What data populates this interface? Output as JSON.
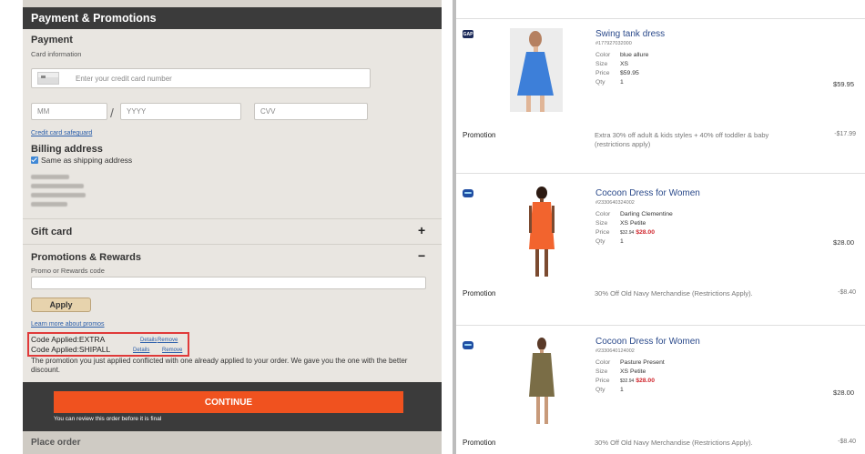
{
  "payment_panel": {
    "header": "Payment & Promotions",
    "payment": {
      "title": "Payment",
      "card_info_label": "Card information",
      "card_number_placeholder": "Enter your credit card number",
      "month_placeholder": "MM",
      "separator": "/",
      "year_placeholder": "YYYY",
      "cvv_placeholder": "CVV",
      "safeguard_link": "Credit card safeguard"
    },
    "billing": {
      "title": "Billing address",
      "same_as_shipping_label": "Same as shipping address",
      "same_as_shipping_checked": true
    },
    "gift_card": {
      "title": "Gift card",
      "toggle": "+"
    },
    "promotions": {
      "title": "Promotions & Rewards",
      "toggle": "−",
      "code_label": "Promo or Rewards code",
      "code_value": "",
      "apply_label": "Apply",
      "learn_more_link": "Learn more about promos",
      "applied_codes": [
        {
          "text": "Code Applied:EXTRA",
          "details": "Details",
          "remove": "Remove"
        },
        {
          "text": "Code Applied:SHIPALL",
          "details": "Details",
          "remove": "Remove"
        }
      ],
      "conflict_message": "The promotion you just applied conflicted with one already applied to your order. We gave you the one with the better discount."
    },
    "continue_label": "CONTINUE",
    "review_note": "You can review this order before it is final",
    "place_order_title": "Place order"
  },
  "order_summary": {
    "items": [
      {
        "brand_icon": "gap-logo",
        "brand_text": "GAP",
        "title": "Swing tank dress",
        "sku": "#177927032000",
        "color": "blue allure",
        "size": "XS",
        "price_label": "$59.95",
        "qty": "1",
        "line_total": "$59.95",
        "promo_label": "Promotion",
        "promo_description": "Extra 30% off adult & kids styles + 40% off toddler & baby (restrictions apply)",
        "promo_amount": "-$17.99",
        "dress_color": "#3d7fd9"
      },
      {
        "brand_icon": "old-navy-logo",
        "title": "Cocoon Dress for Women",
        "sku": "#2330640324002",
        "color": "Darling Clementine",
        "size": "XS Petite",
        "price_original": "$32.94",
        "price_sale": "$28.00",
        "qty": "1",
        "line_total": "$28.00",
        "promo_label": "Promotion",
        "promo_description": "30% Off Old Navy Merchandise (Restrictions Apply).",
        "promo_amount": "-$8.40",
        "dress_color": "#f2642e"
      },
      {
        "brand_icon": "old-navy-logo",
        "title": "Cocoon Dress for Women",
        "sku": "#2330640124002",
        "color": "Pasture Present",
        "size": "XS Petite",
        "price_original": "$32.94",
        "price_sale": "$28.00",
        "qty": "1",
        "line_total": "$28.00",
        "promo_label": "Promotion",
        "promo_description": "30% Off Old Navy Merchandise (Restrictions Apply).",
        "promo_amount": "-$8.40",
        "dress_color": "#7a6d46"
      }
    ],
    "labels": {
      "color": "Color",
      "size": "Size",
      "price": "Price",
      "qty": "Qty"
    }
  }
}
